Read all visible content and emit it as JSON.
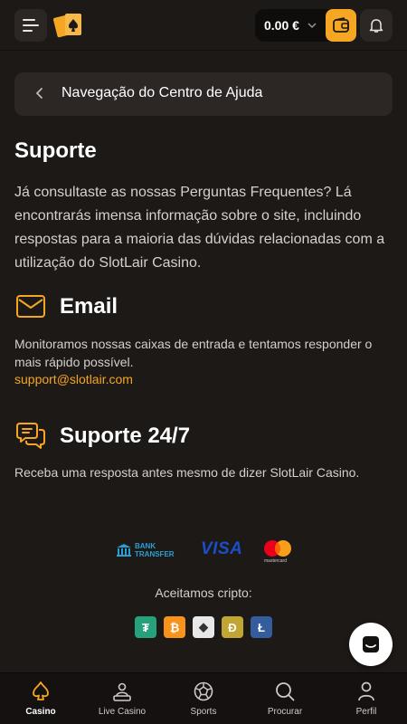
{
  "header": {
    "balance": "0.00 €",
    "menu_icon": "hamburger-icon",
    "wallet_icon": "wallet-icon",
    "bell_icon": "bell-icon"
  },
  "help_nav": {
    "title": "Navegação do Centro de Ajuda"
  },
  "support": {
    "title": "Suporte",
    "intro": "Já consultaste as nossas Perguntas Frequentes? Lá encontrarás imensa informação sobre o site, incluindo respostas para a maioria das dúvidas relacionadas com a utilização do SlotLair Casino."
  },
  "email_section": {
    "title": "Email",
    "text": "Monitoramos nossas caixas de entrada e tentamos responder o mais rápido possível.",
    "link": "support@slotlair.com"
  },
  "live_section": {
    "title": "Suporte 24/7",
    "text": "Receba uma resposta antes mesmo de dizer SlotLair Casino."
  },
  "payments": {
    "bank_line1": "BANK",
    "bank_line2": "TRANSFER",
    "visa": "VISA",
    "mastercard": "mastercard",
    "crypto_label": "Aceitamos cripto:",
    "coins": [
      {
        "icon": "tether-icon",
        "glyph": "₮",
        "color": "#26a17b"
      },
      {
        "icon": "bitcoin-icon",
        "glyph": "₿",
        "color": "#f7931a"
      },
      {
        "icon": "ethereum-icon",
        "glyph": "◆",
        "color": "#e8e8e8"
      },
      {
        "icon": "dogecoin-icon",
        "glyph": "Ð",
        "color": "#c2a633"
      },
      {
        "icon": "litecoin-icon",
        "glyph": "Ł",
        "color": "#345d9d"
      }
    ]
  },
  "bottom_nav": {
    "items": [
      {
        "label": "Casino",
        "icon": "casino-icon",
        "active": true
      },
      {
        "label": "Live Casino",
        "icon": "live-casino-icon",
        "active": false
      },
      {
        "label": "Sports",
        "icon": "sports-icon",
        "active": false
      },
      {
        "label": "Procurar",
        "icon": "search-icon",
        "active": false
      },
      {
        "label": "Perfil",
        "icon": "profile-icon",
        "active": false
      }
    ]
  },
  "colors": {
    "accent": "#f5a623",
    "background": "#1d1917",
    "card": "#2c2725"
  }
}
